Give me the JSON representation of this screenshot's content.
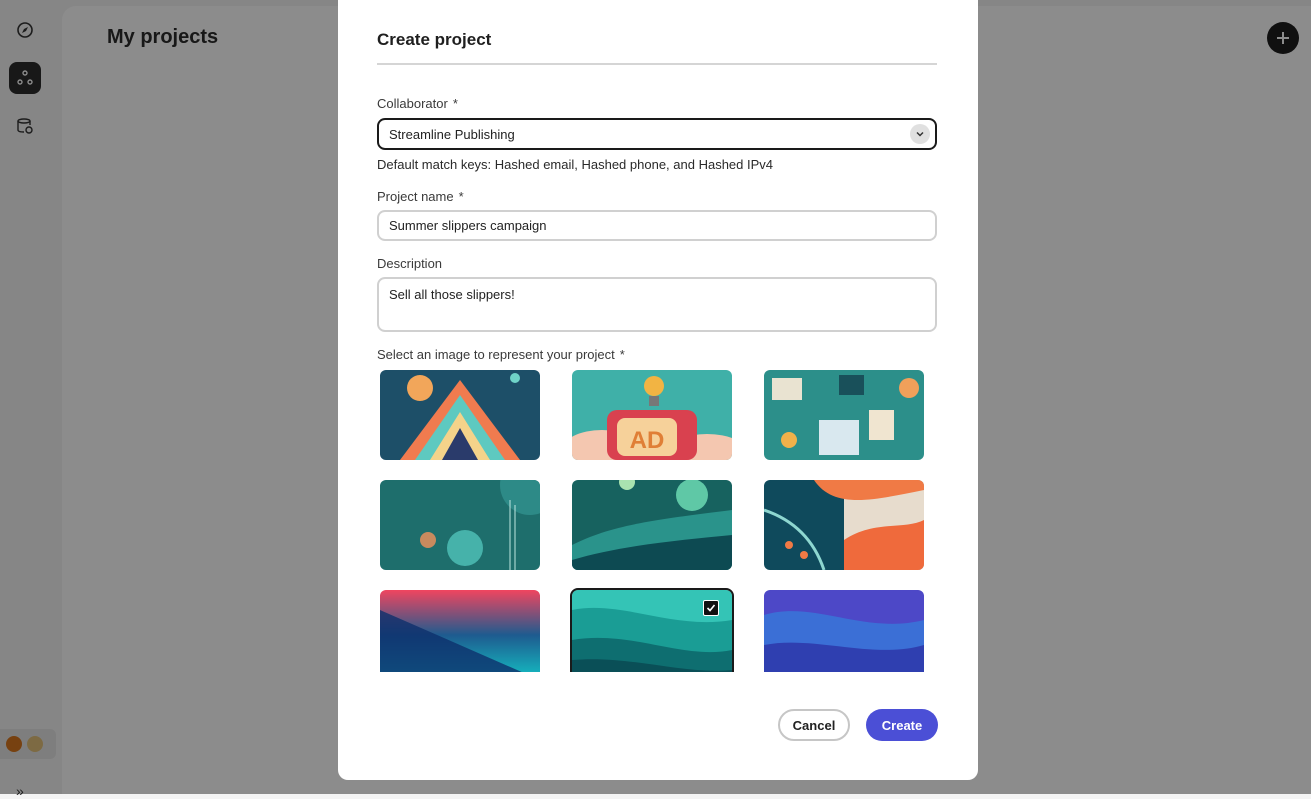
{
  "page": {
    "title": "My projects"
  },
  "rail": {
    "icons": [
      "compass-icon",
      "projects-icon",
      "data-settings-icon"
    ],
    "expand_glyph": "»"
  },
  "dialog": {
    "title": "Create project",
    "collaborator": {
      "label": "Collaborator",
      "required": "*",
      "value": "Streamline Publishing"
    },
    "helper_text": "Default match keys: Hashed email, Hashed phone, and Hashed IPv4",
    "project_name": {
      "label": "Project name",
      "required": "*",
      "value": "Summer slippers campaign"
    },
    "description": {
      "label": "Description",
      "value": "Sell all those slippers!"
    },
    "image_select": {
      "label": "Select an image to represent your project",
      "required": "*",
      "selected_index": 7
    },
    "buttons": {
      "cancel": "Cancel",
      "create": "Create"
    }
  },
  "colors": {
    "accent": "#4b4fd6",
    "dark": "#1e1e1e"
  }
}
